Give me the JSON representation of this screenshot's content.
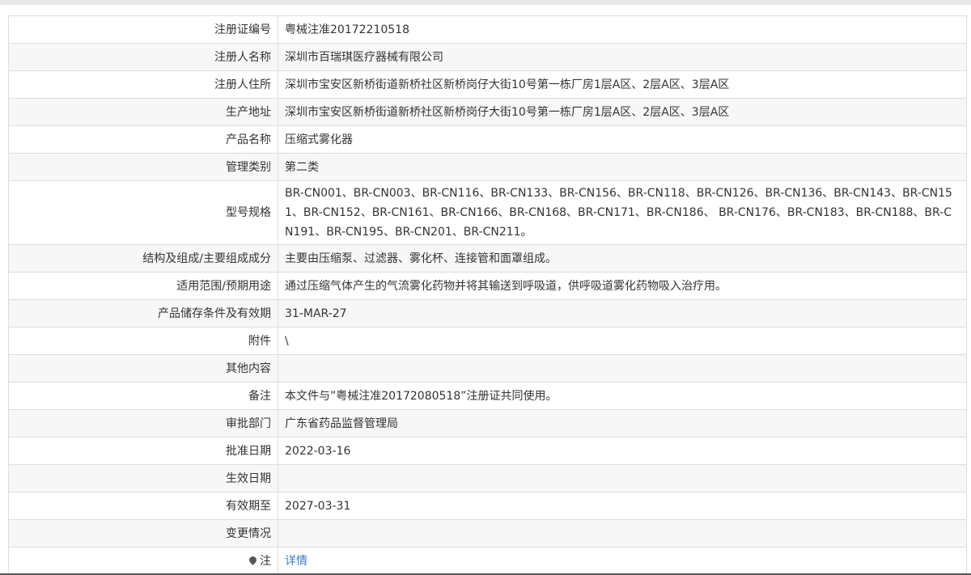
{
  "rows": [
    {
      "label": "注册证编号",
      "value": "粤械注准20172210518"
    },
    {
      "label": "注册人名称",
      "value": "深圳市百瑞琪医疗器械有限公司"
    },
    {
      "label": "注册人住所",
      "value": "深圳市宝安区新桥街道新桥社区新桥岗仔大街10号第一栋厂房1层A区、2层A区、3层A区"
    },
    {
      "label": "生产地址",
      "value": "深圳市宝安区新桥街道新桥社区新桥岗仔大街10号第一栋厂房1层A区、2层A区、3层A区"
    },
    {
      "label": "产品名称",
      "value": "压缩式雾化器"
    },
    {
      "label": "管理类别",
      "value": "第二类"
    },
    {
      "label": "型号规格",
      "value": "BR-CN001、BR-CN003、BR-CN116、BR-CN133、BR-CN156、BR-CN118、BR-CN126、BR-CN136、BR-CN143、BR-CN151、BR-CN152、BR-CN161、BR-CN166、BR-CN168、BR-CN171、BR-CN186、 BR-CN176、BR-CN183、BR-CN188、BR-CN191、BR-CN195、BR-CN201、BR-CN211。"
    },
    {
      "label": "结构及组成/主要组成成分",
      "value": "主要由压缩泵、过滤器、雾化杯、连接管和面罩组成。"
    },
    {
      "label": "适用范围/预期用途",
      "value": "通过压缩气体产生的气流雾化药物并将其输送到呼吸道，供呼吸道雾化药物吸入治疗用。"
    },
    {
      "label": "产品储存条件及有效期",
      "value": "31-MAR-27"
    },
    {
      "label": "附件",
      "value": "\\"
    },
    {
      "label": "其他内容",
      "value": ""
    },
    {
      "label": "备注",
      "value": "本文件与”粤械注准20172080518”注册证共同使用。"
    },
    {
      "label": "审批部门",
      "value": "广东省药品监督管理局"
    },
    {
      "label": "批准日期",
      "value": "2022-03-16"
    },
    {
      "label": "生效日期",
      "value": ""
    },
    {
      "label": "有效期至",
      "value": "2027-03-31"
    },
    {
      "label": "变更情况",
      "value": ""
    }
  ],
  "note": {
    "icon": "lightbulb-icon",
    "label": "注",
    "link_text": "详情"
  },
  "colors": {
    "border": "#dddddd",
    "alt_row": "#f7f7f7",
    "link": "#3a7bd5"
  }
}
